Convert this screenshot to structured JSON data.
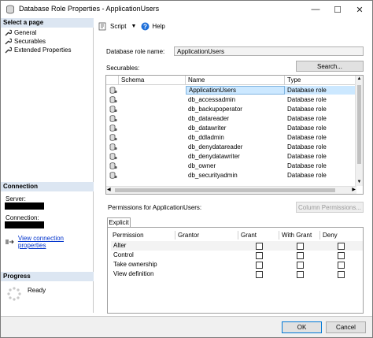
{
  "window": {
    "title": "Database Role Properties - ApplicationUsers",
    "minimize": "—",
    "maximize": "☐",
    "close": "✕"
  },
  "left": {
    "select_page_header": "Select a page",
    "pages": [
      "General",
      "Securables",
      "Extended Properties"
    ],
    "connection_header": "Connection",
    "server_label": "Server:",
    "connection_label": "Connection:",
    "view_link": "View connection properties",
    "progress_header": "Progress",
    "ready": "Ready"
  },
  "toolbar": {
    "script_label": "Script",
    "help_label": "Help"
  },
  "main": {
    "role_name_label": "Database role name:",
    "role_name_value": "ApplicationUsers",
    "securables_label": "Securables:",
    "search_button": "Search...",
    "columns": [
      "Schema",
      "Name",
      "Type"
    ],
    "rows": [
      {
        "schema": "",
        "name": "ApplicationUsers",
        "type": "Database role"
      },
      {
        "schema": "",
        "name": "db_accessadmin",
        "type": "Database role"
      },
      {
        "schema": "",
        "name": "db_backupoperator",
        "type": "Database role"
      },
      {
        "schema": "",
        "name": "db_datareader",
        "type": "Database role"
      },
      {
        "schema": "",
        "name": "db_datawriter",
        "type": "Database role"
      },
      {
        "schema": "",
        "name": "db_ddladmin",
        "type": "Database role"
      },
      {
        "schema": "",
        "name": "db_denydatareader",
        "type": "Database role"
      },
      {
        "schema": "",
        "name": "db_denydatawriter",
        "type": "Database role"
      },
      {
        "schema": "",
        "name": "db_owner",
        "type": "Database role"
      },
      {
        "schema": "",
        "name": "db_securityadmin",
        "type": "Database role"
      }
    ],
    "permissions_label": "Permissions for ApplicationUsers:",
    "column_permissions_button": "Column Permissions...",
    "tab_explicit": "Explicit",
    "perm_columns": [
      "Permission",
      "Grantor",
      "Grant",
      "With Grant",
      "Deny"
    ],
    "permissions": [
      {
        "permission": "Alter",
        "grantor": "",
        "grant": false,
        "with_grant": false,
        "deny": false
      },
      {
        "permission": "Control",
        "grantor": "",
        "grant": false,
        "with_grant": false,
        "deny": false
      },
      {
        "permission": "Take ownership",
        "grantor": "",
        "grant": false,
        "with_grant": false,
        "deny": false
      },
      {
        "permission": "View definition",
        "grantor": "",
        "grant": false,
        "with_grant": false,
        "deny": false
      }
    ]
  },
  "footer": {
    "ok": "OK",
    "cancel": "Cancel"
  },
  "colors": {
    "selection": "#cce8ff",
    "section_header": "#dce6f2",
    "link": "#0033cc"
  }
}
